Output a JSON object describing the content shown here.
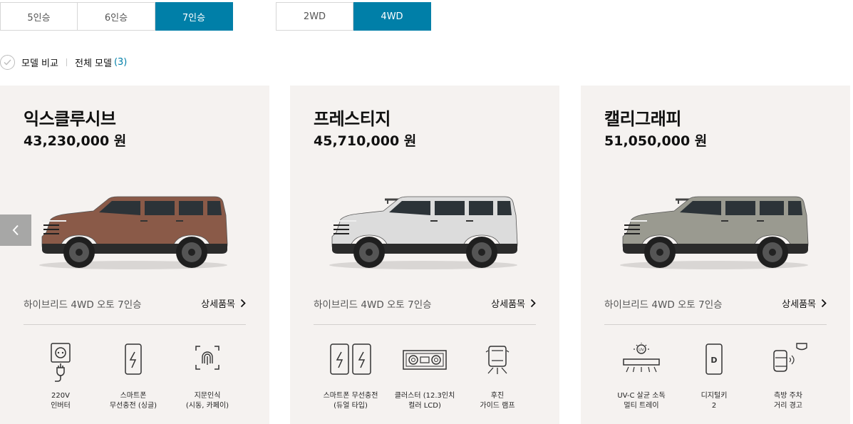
{
  "filters": {
    "seats": [
      "5인승",
      "6인승",
      "7인승"
    ],
    "seats_active": "7인승",
    "drive": [
      "2WD",
      "4WD"
    ],
    "drive_active": "4WD"
  },
  "compare": {
    "label": "모델 비교",
    "all_models_label": "전체 모델",
    "count": "(3)"
  },
  "colors": {
    "accent": "#007fa8",
    "card_bg": "#f5f2f0",
    "car_exclusive": "#8a5a48",
    "car_prestige": "#dcdcdc",
    "car_calligraphy": "#9a9a90"
  },
  "cards": [
    {
      "name": "익스클루시브",
      "price": "43,230,000 원",
      "trim": "하이브리드 4WD 오토 7인승",
      "detail_label": "상세품목",
      "car_color": "brown",
      "features": [
        {
          "icon": "power-outlet-icon",
          "label": "220V\n인버터"
        },
        {
          "icon": "wireless-charging-phone-icon",
          "label": "스마트폰\n무선충전 (싱글)"
        },
        {
          "icon": "fingerprint-icon",
          "label": "지문인식\n(시동, 카페이)"
        }
      ]
    },
    {
      "name": "프레스티지",
      "price": "45,710,000 원",
      "trim": "하이브리드 4WD 오토 7인승",
      "detail_label": "상세품목",
      "car_color": "white",
      "features": [
        {
          "icon": "dual-wireless-charging-icon",
          "label": "스마트폰 무선충전\n(듀얼 타입)"
        },
        {
          "icon": "instrument-cluster-icon",
          "label": "클러스터 (12.3인치\n컬러 LCD)"
        },
        {
          "icon": "rear-guide-lamp-icon",
          "label": "후진\n가이드 램프"
        }
      ]
    },
    {
      "name": "캘리그래피",
      "price": "51,050,000 원",
      "trim": "하이브리드 4WD 오토 7인승",
      "detail_label": "상세품목",
      "car_color": "gray",
      "features": [
        {
          "icon": "uv-c-sterilization-tray-icon",
          "label": "UV-C 살균 소독\n멀티 트레이"
        },
        {
          "icon": "digital-key-icon",
          "label": "디지털키\n2"
        },
        {
          "icon": "side-parking-distance-warning-icon",
          "label": "측방 주차\n거리 경고"
        }
      ]
    }
  ]
}
